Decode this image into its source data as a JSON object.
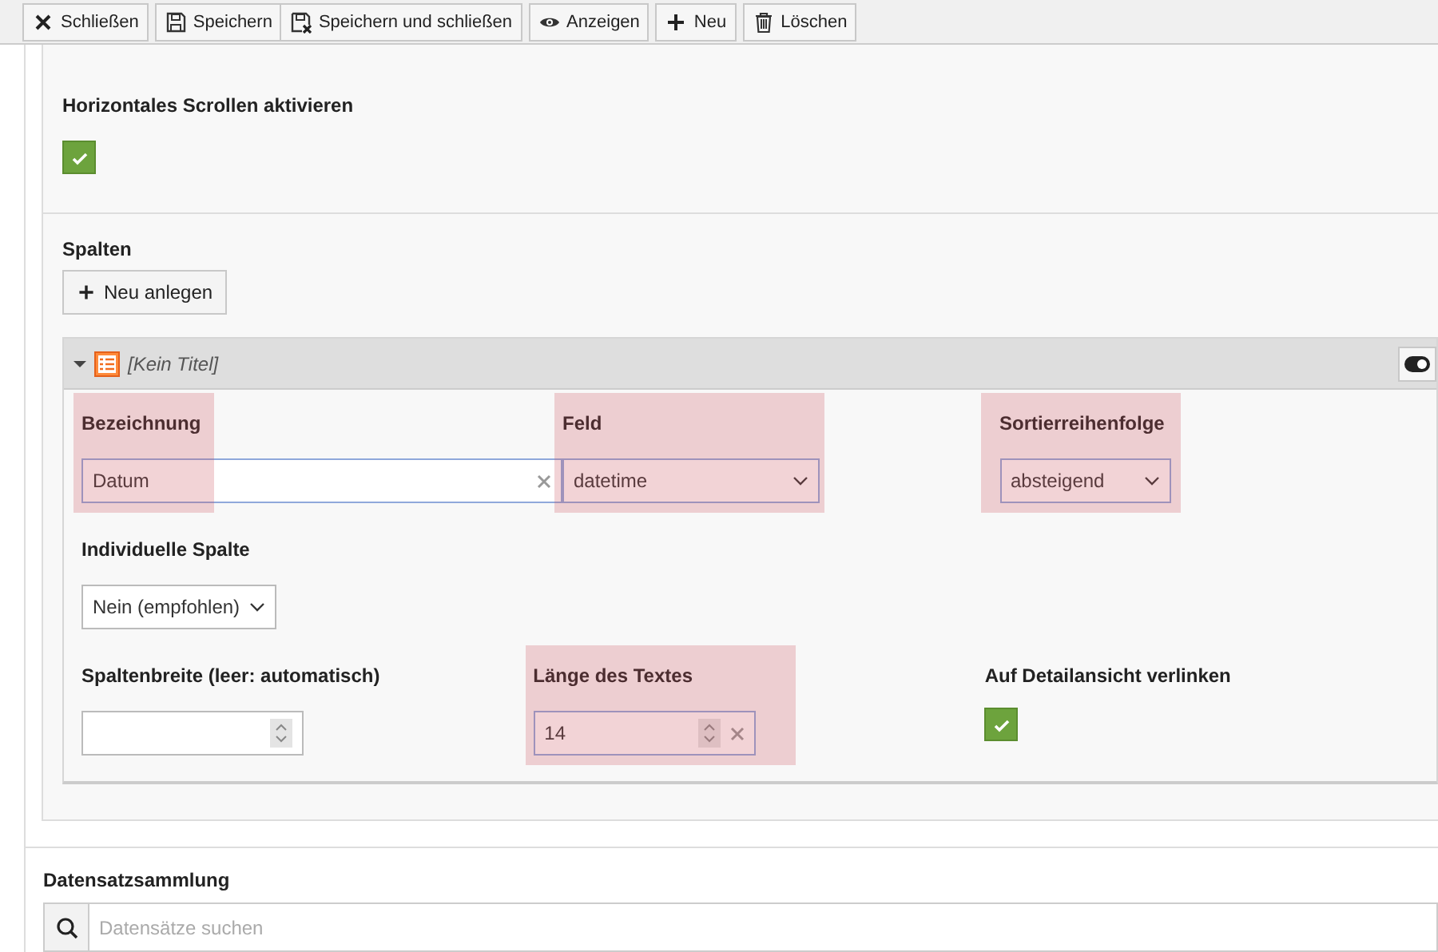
{
  "toolbar": {
    "groups": [
      [
        {
          "label": "Schließen"
        }
      ],
      [
        {
          "label": "Speichern"
        },
        {
          "label": "Speichern und schließen"
        }
      ],
      [
        {
          "label": "Anzeigen"
        }
      ],
      [
        {
          "label": "Neu"
        }
      ],
      [
        {
          "label": "Löschen"
        }
      ]
    ]
  },
  "scroll_setting": {
    "label": "Horizontales Scrollen aktivieren",
    "checked": true
  },
  "columns_section": {
    "title": "Spalten",
    "add_button": "Neu anlegen",
    "items": [
      {
        "title": "[Kein Titel]",
        "expanded": true,
        "enabled": true,
        "rows": [
          [
            {
              "kind": "text",
              "label": "Bezeichnung",
              "value": "Datum",
              "highlighted": true,
              "clearable": true
            },
            {
              "kind": "select",
              "label": "Feld",
              "value": "datetime",
              "highlighted": true
            },
            {
              "kind": "select",
              "label": "Sortierreihenfolge",
              "value": "absteigend",
              "highlighted": true
            }
          ],
          [
            {
              "kind": "select",
              "label": "Individuelle Spalte",
              "value": "Nein (empfohlen)",
              "highlighted": false
            }
          ],
          [
            {
              "kind": "number",
              "label": "Spaltenbreite (leer: automatisch)",
              "highlighted": false,
              "clearable": false
            },
            {
              "kind": "number",
              "label": "Länge des Textes",
              "value": "14",
              "highlighted": true,
              "clearable": true
            },
            {
              "kind": "checkbox",
              "label": "Auf Detailansicht verlinken",
              "checked": true,
              "highlighted": false
            }
          ]
        ]
      }
    ]
  },
  "record_collection": {
    "title": "Datensatzsammlung",
    "search": {
      "placeholder": "Datensätze suchen"
    }
  }
}
